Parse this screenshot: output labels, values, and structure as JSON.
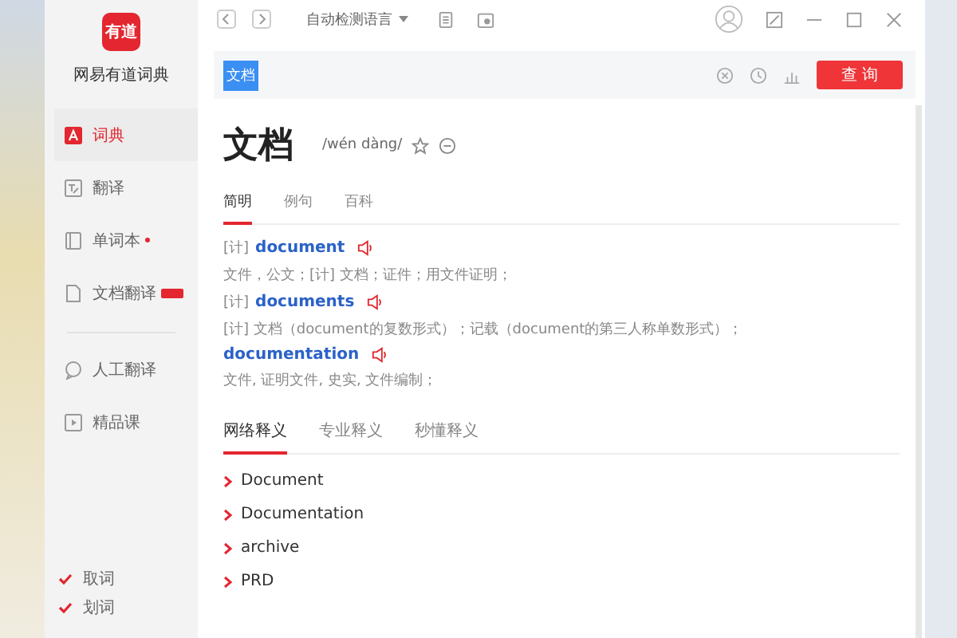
{
  "app": {
    "logo": "有道",
    "name": "网易有道词典"
  },
  "sidebar": {
    "items": [
      {
        "label": "词典",
        "selected": true,
        "dot": false,
        "badge": false
      },
      {
        "label": "翻译",
        "selected": false,
        "dot": false,
        "badge": false
      },
      {
        "label": "单词本",
        "selected": false,
        "dot": true,
        "badge": false
      },
      {
        "label": "文档翻译",
        "selected": false,
        "dot": false,
        "badge": true
      },
      {
        "label": "人工翻译",
        "selected": false,
        "dot": false,
        "badge": false
      },
      {
        "label": "精品课",
        "selected": false,
        "dot": false,
        "badge": false
      }
    ],
    "options": [
      {
        "label": "取词",
        "checked": true
      },
      {
        "label": "划词",
        "checked": true
      }
    ]
  },
  "toolbar": {
    "language": "自动检测语言"
  },
  "search": {
    "value": "文档",
    "button": "查 询"
  },
  "word": {
    "headword": "文档",
    "phonetic": "/wén dàng/"
  },
  "tabs": [
    {
      "label": "简明",
      "selected": true
    },
    {
      "label": "例句",
      "selected": false
    },
    {
      "label": "百科",
      "selected": false
    }
  ],
  "entries": [
    {
      "tag": "[计]",
      "term": "document",
      "definition": "文件，公文；[计] 文档；证件；用文件证明；"
    },
    {
      "tag": "[计]",
      "term": "documents",
      "definition": "[计] 文档（document的复数形式）；记载（document的第三人称单数形式）；"
    },
    {
      "term": "documentation",
      "definition": "文件, 证明文件, 史实, 文件编制；"
    }
  ],
  "web_tabs": [
    {
      "label": "网络释义",
      "selected": true
    },
    {
      "label": "专业释义",
      "selected": false
    },
    {
      "label": "秒懂释义",
      "selected": false
    }
  ],
  "web_items": [
    "Document",
    "Documentation",
    "archive",
    "PRD"
  ]
}
